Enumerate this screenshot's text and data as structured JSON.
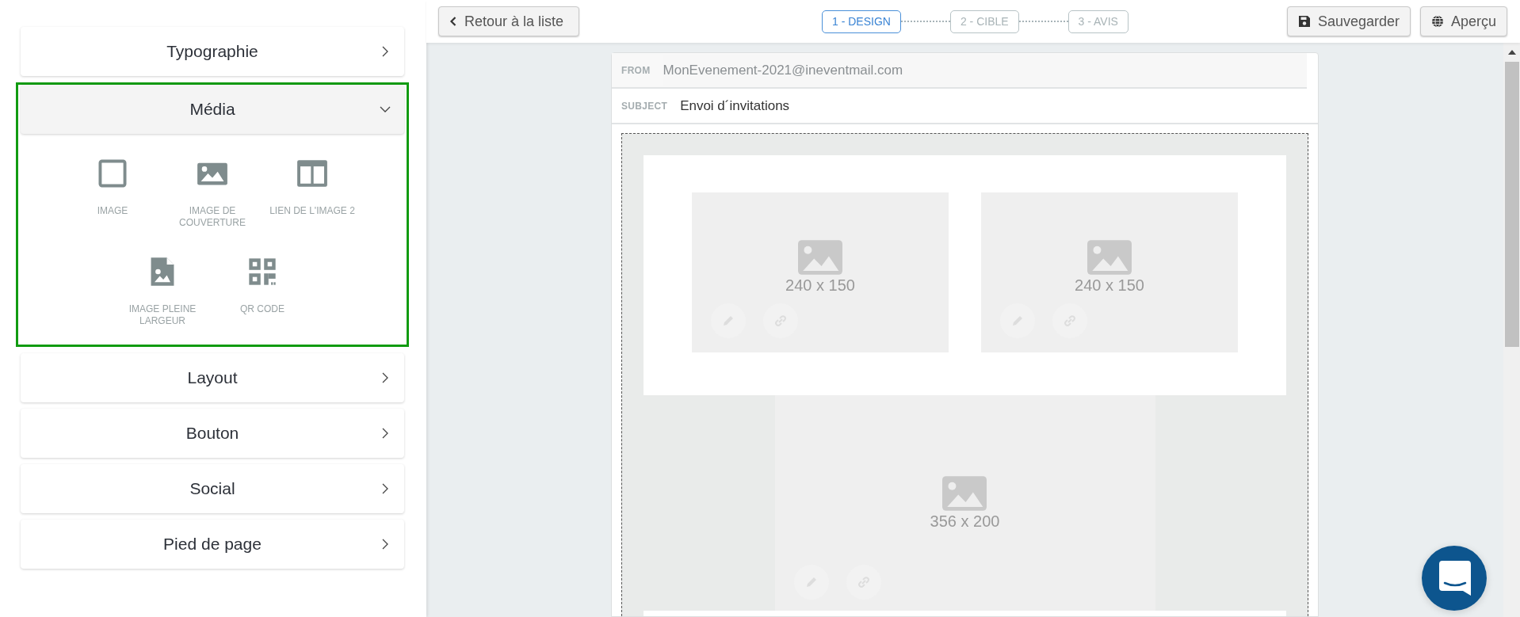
{
  "sidebar": {
    "sections": [
      {
        "title": "Typographie",
        "expanded": false
      },
      {
        "title": "Média",
        "expanded": true,
        "highlighted": true,
        "items": [
          {
            "label": "IMAGE",
            "kind": "frame"
          },
          {
            "label": "IMAGE DE COUVERTURE",
            "kind": "photo"
          },
          {
            "label": "LIEN DE L'IMAGE 2",
            "kind": "columns"
          },
          {
            "label": "IMAGE PLEINE LARGEUR",
            "kind": "file"
          },
          {
            "label": "QR CODE",
            "kind": "qr"
          }
        ]
      },
      {
        "title": "Layout",
        "expanded": false
      },
      {
        "title": "Bouton",
        "expanded": false
      },
      {
        "title": "Social",
        "expanded": false
      },
      {
        "title": "Pied de page",
        "expanded": false
      }
    ]
  },
  "toolbar": {
    "back": "Retour à la liste",
    "steps": [
      {
        "label": "1 - DESIGN",
        "selected": true
      },
      {
        "label": "2 - CIBLE",
        "selected": false
      },
      {
        "label": "3 - AVIS",
        "selected": false
      }
    ],
    "buttons": [
      {
        "label": "Sauvegarder",
        "kind": "save"
      },
      {
        "label": "Aperçu",
        "kind": "preview"
      }
    ]
  },
  "email": {
    "from_label": "FROM",
    "from": "MonEvenement-2021@ineventmail.com",
    "subject_label": "SUBJECT",
    "subject": "Envoi d´invitations",
    "rows": [
      {
        "kind": "boxed",
        "images": [
          "240 x 150",
          "240 x 150"
        ]
      },
      {
        "kind": "plain",
        "images": [
          "356 x 200"
        ]
      }
    ]
  }
}
